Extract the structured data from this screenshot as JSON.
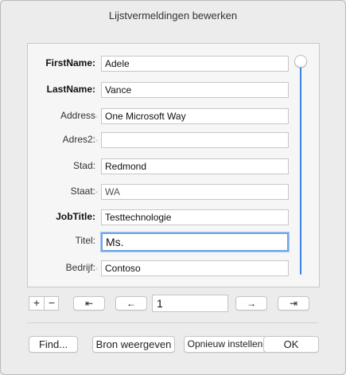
{
  "window": {
    "title": "Lijstvermeldingen bewerken"
  },
  "fields": [
    {
      "label": "FirstName:",
      "value": "Adele",
      "bold": true
    },
    {
      "label": "LastName:",
      "value": "Vance",
      "bold": true
    },
    {
      "label": "Address",
      "value": "One Microsoft Way",
      "bold": false
    },
    {
      "label": "Adres2:",
      "value": "",
      "bold": false
    },
    {
      "label": "Stad:",
      "value": "Redmond",
      "bold": false
    },
    {
      "label": "Staat:",
      "value": "WA",
      "bold": false
    },
    {
      "label": "JobTitle:",
      "value": "Testtechnologie",
      "bold": true
    },
    {
      "label": "Titel:",
      "value": "Ms.",
      "bold": false,
      "focused": true
    },
    {
      "label": "Bedrijf:",
      "value": "Contoso",
      "bold": false
    }
  ],
  "nav": {
    "add_label": "+",
    "remove_label": "−",
    "first_label": "⇤",
    "prev_label": "←",
    "record_value": "1",
    "next_label": "→",
    "last_label": "⇥"
  },
  "buttons": {
    "find_label": "Find...",
    "view_source_label": "Bron weergeven",
    "reset_label": "Opnieuw instellen",
    "ok_label": "OK"
  },
  "colors": {
    "accent": "#3d82e6",
    "focus_ring": "#6ea6e8"
  }
}
